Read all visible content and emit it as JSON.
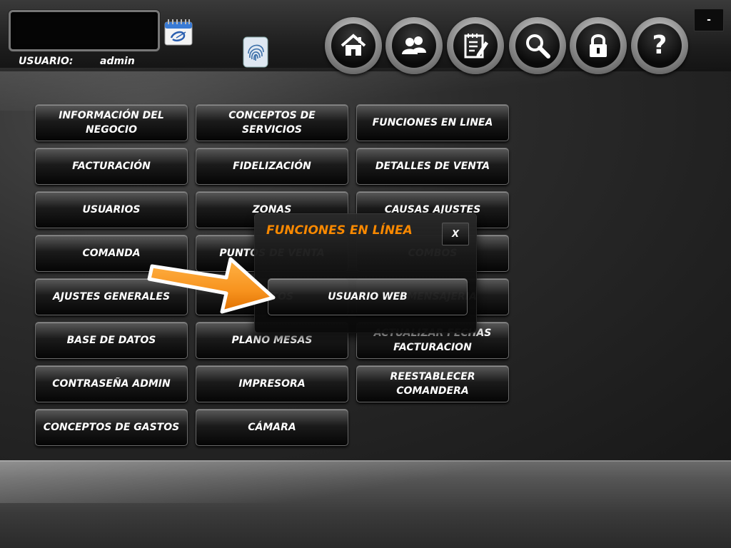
{
  "header": {
    "user_label": "USUARIO:",
    "user_value": "admin",
    "calendar_icon": "calendar-icon",
    "fingerprint_icon": "fingerprint-icon",
    "minimize_label": "-",
    "help_label": "?",
    "nav_icons": [
      "home-icon",
      "users-icon",
      "notepad-icon",
      "search-icon",
      "lock-icon",
      "help-icon"
    ]
  },
  "menu": {
    "informacion_negocio": [
      "INFORMACIÓN DEL",
      "NEGOCIO"
    ],
    "conceptos_servicios": "CONCEPTOS DE SERVICIOS",
    "funciones_linea": "FUNCIONES EN LINEA",
    "facturacion": "FACTURACIÓN",
    "fidelizacion": "FIDELIZACIÓN",
    "detalles_venta": "DETALLES DE VENTA",
    "usuarios": "USUARIOS",
    "zonas": "ZONAS",
    "causas_ajustes": "CAUSAS AJUSTES",
    "comanda": "COMANDA",
    "puntos_venta": "PUNTOS DE VENTA",
    "combos": "COMBOS",
    "ajustes_generales": "AJUSTES GENERALES",
    "platos": "PLATOS",
    "mensajeria": "DE MENSAJERIA",
    "base_datos": "BASE DE DATOS",
    "plano_mesas": "PLANO MESAS",
    "actualizar_fechas": [
      "ACTUALIZAR FECHAS",
      "FACTURACION"
    ],
    "contrasena_admin": "CONTRASEÑA ADMIN",
    "impresora": "IMPRESORA",
    "reestablecer_comandera": "REESTABLECER COMANDERA",
    "conceptos_gastos": "CONCEPTOS DE GASTOS",
    "camara": "CÁMARA"
  },
  "dialog": {
    "title": "FUNCIONES EN LÍNEA",
    "close_label": "X",
    "usuario_web_label": "USUARIO WEB"
  },
  "colors": {
    "dialog_title": "#ff8c00",
    "arrow": "#f7931e",
    "button_text": "#ffffff"
  }
}
